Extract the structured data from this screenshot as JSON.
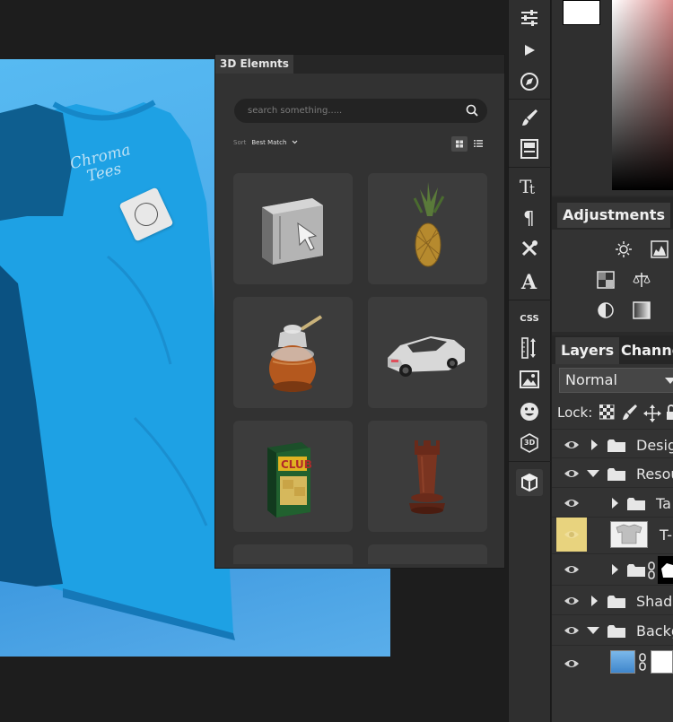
{
  "panel3d": {
    "tab_title": "3D Elemnts",
    "search_placeholder": "search something.....",
    "sort_label": "Sort",
    "sort_value": "Best Match",
    "items": [
      {
        "name": "mac-pro-tower"
      },
      {
        "name": "pineapple"
      },
      {
        "name": "honey-jar"
      },
      {
        "name": "sports-car"
      },
      {
        "name": "club-crackers-box"
      },
      {
        "name": "chess-rook"
      }
    ]
  },
  "canvas": {
    "shirt_brand_line1": "Chroma",
    "shirt_brand_line2": "Tees"
  },
  "toolstrip": {
    "icons": [
      "sliders-icon",
      "play-icon",
      "compass-icon",
      "brush-icon",
      "layout-icon",
      "text-tt-icon",
      "pilcrow-icon",
      "tools-icon",
      "font-a-icon",
      "css-icon",
      "ruler-icon",
      "image-icon",
      "emoji-icon",
      "3d-icon",
      "cube-icon"
    ],
    "css_label": "CSS",
    "threed_label": "3D"
  },
  "adjustments": {
    "tab_title": "Adjustments"
  },
  "layers": {
    "tab_title": "Layers",
    "channels_title": "Channe",
    "blend_mode": "Normal",
    "lock_label": "Lock:",
    "rows": [
      {
        "name": "Desig"
      },
      {
        "name": "Resou"
      },
      {
        "name": "Ta"
      },
      {
        "name": "T-"
      },
      {
        "name": ""
      },
      {
        "name": "Shado"
      },
      {
        "name": "Backg"
      },
      {
        "name": ""
      }
    ]
  },
  "colors": {
    "accent_selected": "#e8d37e",
    "panel_bg": "#323232",
    "doc_bg": "#4aa8e8"
  }
}
